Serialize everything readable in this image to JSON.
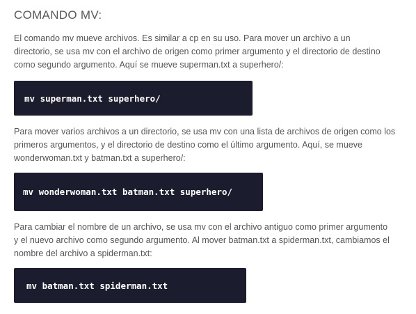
{
  "title": "COMANDO MV:",
  "sections": [
    {
      "text": "El comando mv mueve archivos. Es similar a cp en su uso. Para mover un archivo a un directorio, se usa mv con el archivo de origen como primer argumento y el directorio de destino como segundo argumento. Aquí se mueve superman.txt a superhero/:",
      "code": "mv superman.txt superhero/"
    },
    {
      "text": "Para mover varios archivos a un directorio, se usa mv con una lista de archivos de origen como los primeros argumentos, y el directorio de destino como el último argumento. Aquí, se mueve wonderwoman.txt y batman.txt a superhero/:",
      "code": "mv wonderwoman.txt batman.txt superhero/"
    },
    {
      "text": "Para cambiar el nombre de un archivo, se usa mv con el archivo antiguo como primer argumento y el nuevo archivo como segundo argumento. Al mover batman.txt a spiderman.txt, cambiamos el nombre del archivo a spiderman.txt:",
      "code": "mv batman.txt spiderman.txt"
    }
  ]
}
